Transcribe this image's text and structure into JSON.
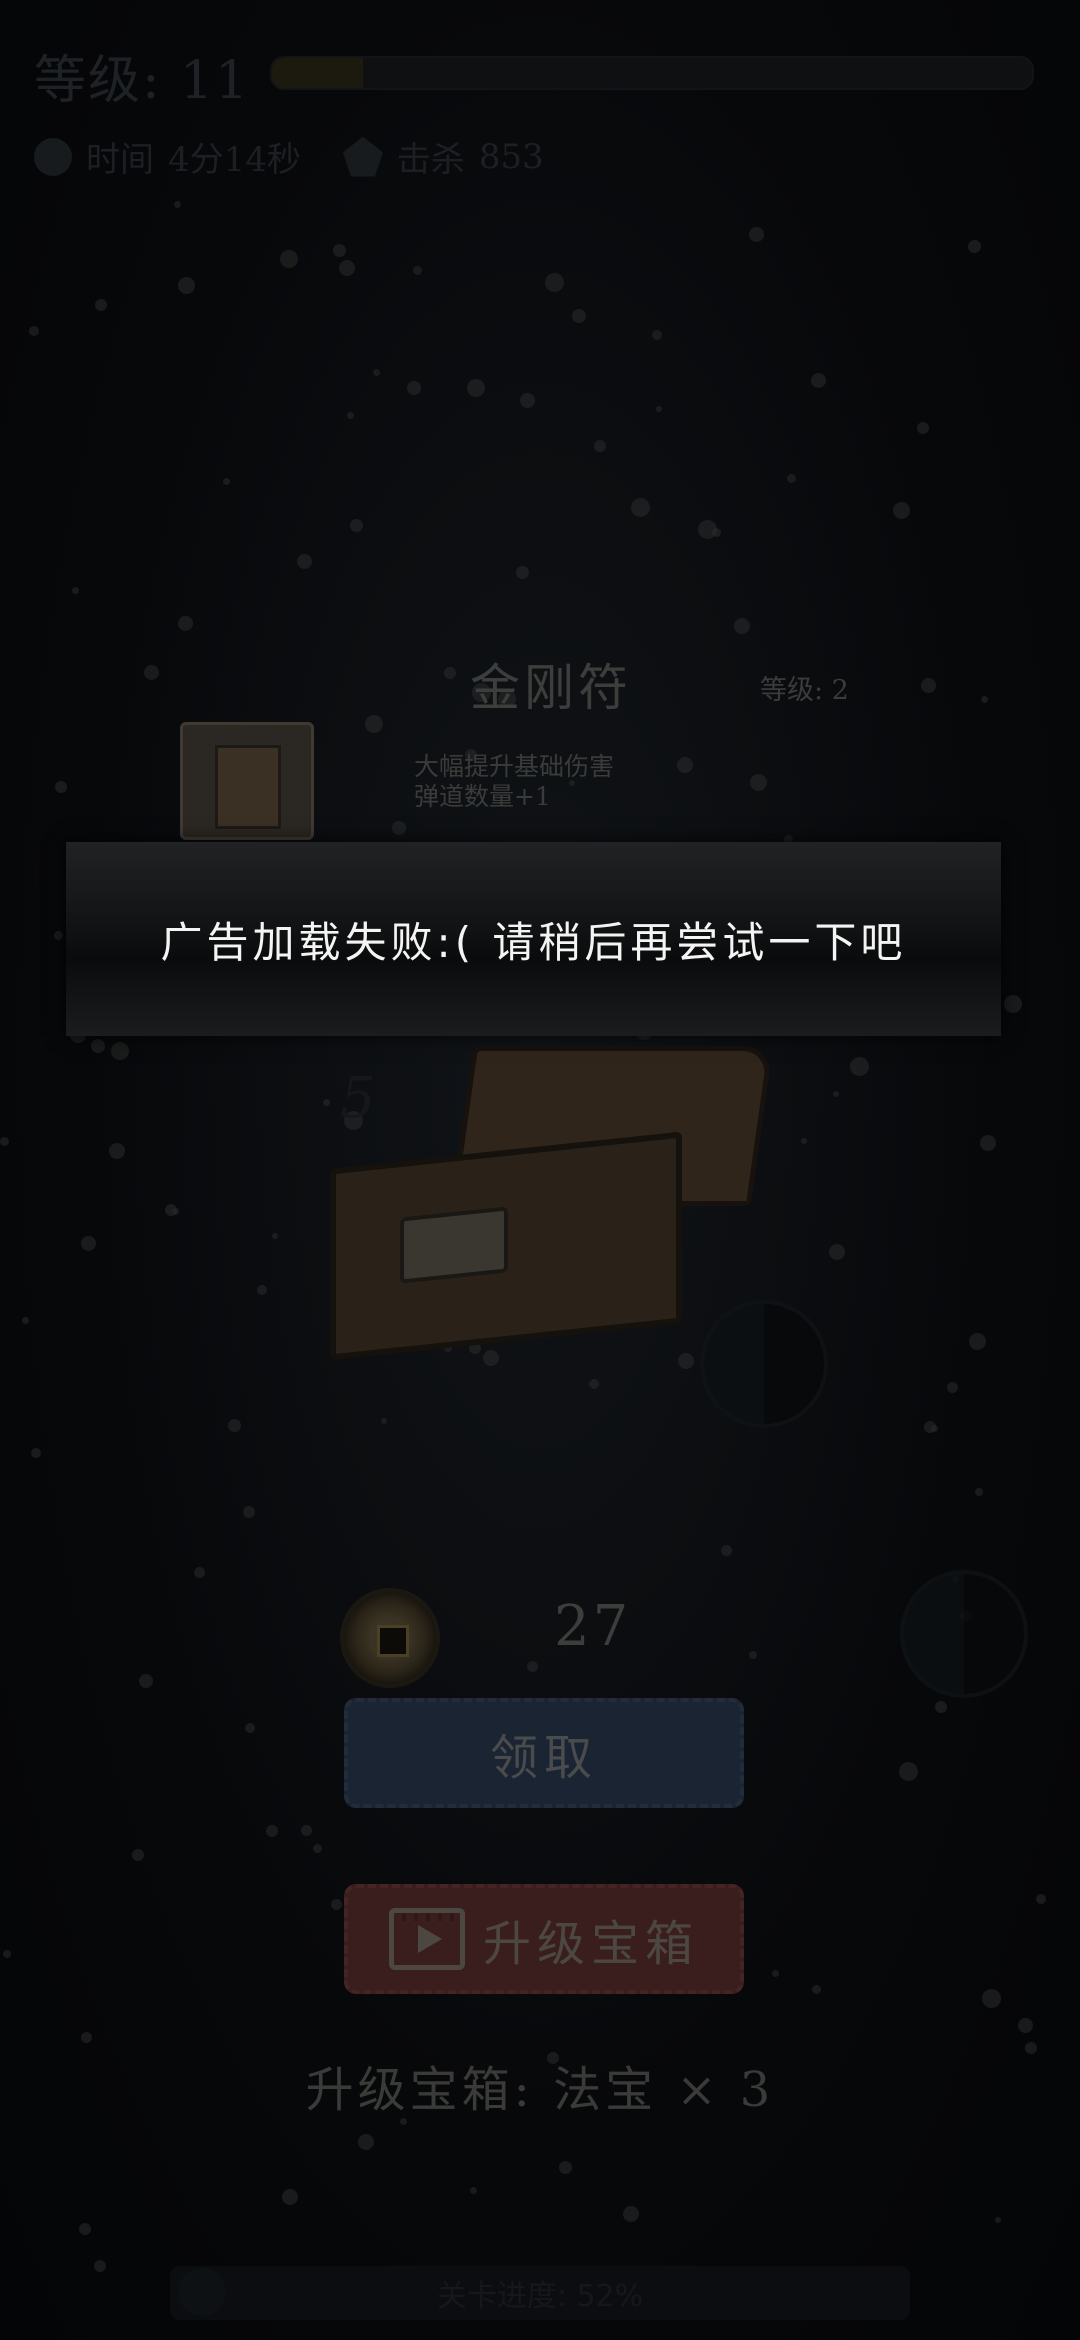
{
  "hud": {
    "level_text": "等级: 11",
    "time_label": "时间",
    "time_value": "4分14秒",
    "kill_label": "击杀",
    "kill_count": "853",
    "xp_progress": 0.12
  },
  "reward": {
    "item_name": "金刚符",
    "item_level": "等级: 2",
    "item_desc_line1": "大幅提升基础伤害",
    "item_desc_line2": "弹道数量+1",
    "chest_number": "5",
    "coin_count": "27",
    "claim_button": "领取",
    "upgrade_button": "升级宝箱",
    "upgrade_info": "升级宝箱: 法宝 × 3"
  },
  "bottom": {
    "progress_text": "关卡进度: 52%"
  },
  "toast": {
    "message": "广告加载失败:( 请稍后再尝试一下吧"
  },
  "colors": {
    "toast_text": "#f4f4f2",
    "claim_button_bg": "#1b2432",
    "upgrade_button_bg": "#3a1e1d"
  },
  "icons": {
    "hud_time": "clock-icon",
    "hud_kill": "skull-icon",
    "coin": "coin-icon",
    "video": "video-play-icon",
    "chest": "treasure-chest-icon"
  }
}
